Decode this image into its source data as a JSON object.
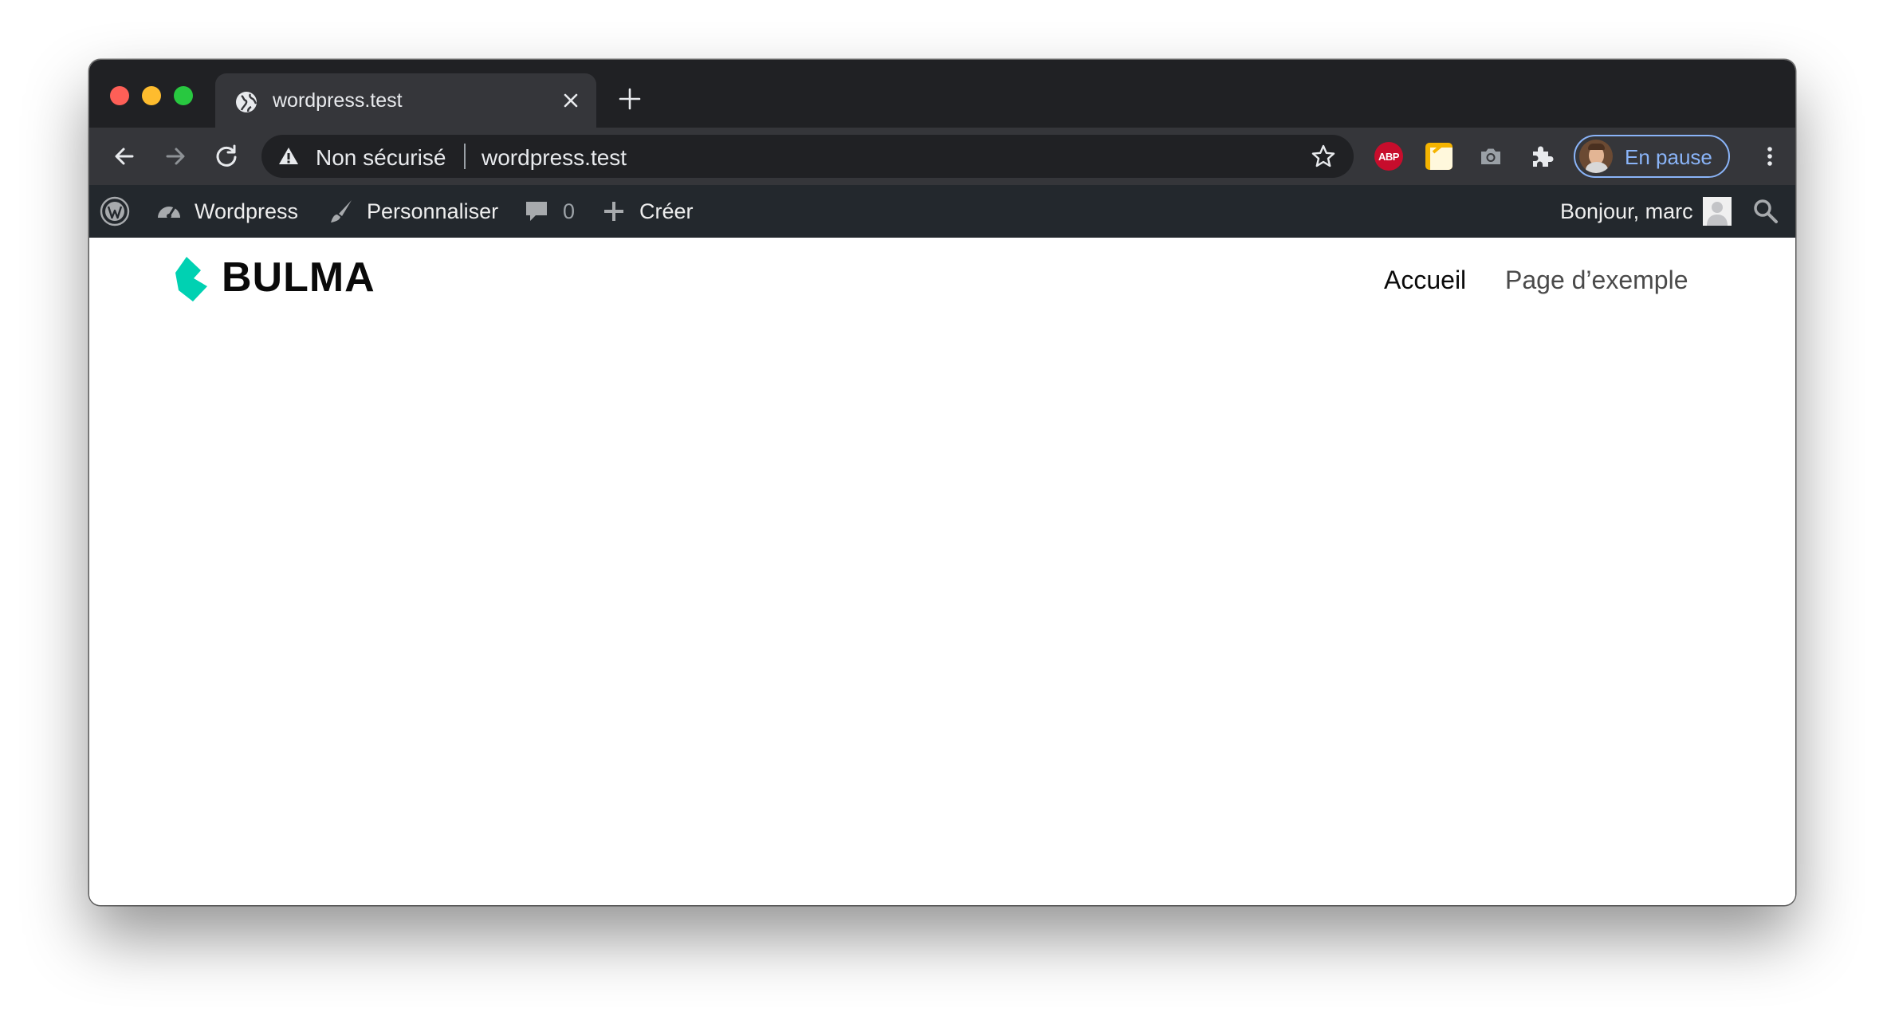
{
  "browser": {
    "tab": {
      "title": "wordpress.test"
    },
    "address_bar": {
      "security_label": "Non sécurisé",
      "url": "wordpress.test"
    },
    "extensions": {
      "abp_label": "ABP"
    },
    "profile": {
      "label": "En pause"
    }
  },
  "admin_bar": {
    "site_name": "Wordpress",
    "customize_label": "Personnaliser",
    "comments_count": "0",
    "new_label": "Créer",
    "greeting": "Bonjour, marc"
  },
  "site": {
    "logo_text": "BULMA",
    "brand_color": "#00d1b2",
    "nav": [
      {
        "label": "Accueil"
      },
      {
        "label": "Page d’exemple"
      }
    ]
  }
}
